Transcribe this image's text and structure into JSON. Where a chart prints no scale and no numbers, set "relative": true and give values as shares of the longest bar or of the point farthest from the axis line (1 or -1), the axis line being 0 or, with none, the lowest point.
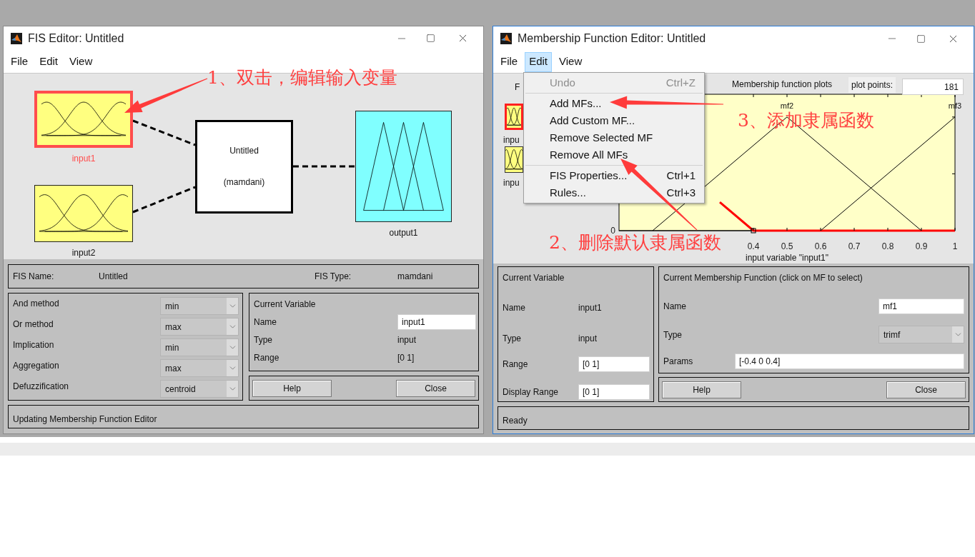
{
  "fis_editor": {
    "title": "FIS Editor: Untitled",
    "menu": [
      {
        "label": "File",
        "selected": false
      },
      {
        "label": "Edit",
        "selected": false
      },
      {
        "label": "View",
        "selected": false
      }
    ],
    "diagram": {
      "inputs": [
        {
          "label": "input1",
          "selected": true
        },
        {
          "label": "input2",
          "selected": false
        }
      ],
      "system": {
        "name": "Untitled",
        "type": "(mamdani)"
      },
      "output": {
        "label": "output1",
        "selected": false
      }
    },
    "fis_name_label": "FIS Name:",
    "fis_name": "Untitled",
    "fis_type_label": "FIS Type:",
    "fis_type": "mamdani",
    "methods": [
      {
        "label": "And method",
        "value": "min"
      },
      {
        "label": "Or method",
        "value": "max"
      },
      {
        "label": "Implication",
        "value": "min"
      },
      {
        "label": "Aggregation",
        "value": "max"
      },
      {
        "label": "Defuzzification",
        "value": "centroid"
      }
    ],
    "current_variable": {
      "title": "Current Variable",
      "name_label": "Name",
      "name": "input1",
      "type_label": "Type",
      "type": "input",
      "range_label": "Range",
      "range": "[0 1]"
    },
    "buttons": [
      "Help",
      "Close"
    ],
    "status": "Updating Membership Function Editor"
  },
  "mf_editor": {
    "title": "Membership Function Editor: Untitled",
    "menu": [
      {
        "label": "File",
        "selected": false
      },
      {
        "label": "Edit",
        "selected": true
      },
      {
        "label": "View",
        "selected": false
      }
    ],
    "variables_title": "F",
    "variables": [
      {
        "label": "inpu",
        "selected": true
      },
      {
        "label": "inpu",
        "selected": false
      }
    ],
    "plot_title": "Membership function plots",
    "plot_points_label": "plot points:",
    "plot_points": "181",
    "chart_data": {
      "type": "line",
      "x": [
        0.1,
        0.2,
        0.3,
        0.4,
        0.5,
        0.6,
        0.7,
        0.8,
        0.9,
        1
      ],
      "xlabel": "input variable \"input1\"",
      "xlim": [
        0,
        1
      ],
      "relative": true,
      "xticks": [
        0.4,
        0.5,
        0.6,
        0.7,
        0.8,
        0.9,
        1
      ],
      "legend": "top",
      "series": [
        {
          "color": "#ff0000",
          "values": [
            null,
            null,
            0.25,
            0,
            0,
            0,
            0,
            0,
            0,
            0
          ]
        },
        {
          "name": "mf2",
          "color": "#000000",
          "values": [
            0,
            0.25,
            0.5,
            0.75,
            1,
            0.75,
            0.5,
            0.25,
            0,
            null
          ]
        },
        {
          "name": "mf3",
          "color": "#000000",
          "values": [
            null,
            null,
            null,
            null,
            null,
            0,
            0.25,
            0.5,
            0.75,
            1
          ]
        }
      ],
      "annotations": [
        "0"
      ]
    },
    "edit_menu": [
      {
        "items": [
          {
            "label": "Undo",
            "shortcut": "Ctrl+Z",
            "disabled": true
          }
        ]
      },
      {
        "items": [
          {
            "label": "Add MFs...",
            "disabled": false
          },
          {
            "label": "Add Custom MF...",
            "disabled": false
          },
          {
            "label": "Remove Selected MF",
            "disabled": false
          },
          {
            "label": "Remove All MFs",
            "disabled": false
          }
        ]
      },
      {
        "items": [
          {
            "label": "FIS Properties...",
            "shortcut": "Ctrl+1",
            "disabled": false
          },
          {
            "label": "Rules...",
            "shortcut": "Ctrl+3",
            "disabled": false
          }
        ]
      }
    ],
    "current_variable": {
      "title": "Current Variable",
      "name_label": "Name",
      "name": "input1",
      "type_label": "Type",
      "type": "input",
      "range_label": "Range",
      "range": "[0 1]",
      "display_range_label": "Display Range",
      "display_range": "[0 1]"
    },
    "current_mf": {
      "title": "Current Membership Function (click on MF to select)",
      "name_label": "Name",
      "name": "mf1",
      "type_label": "Type",
      "type": "trimf",
      "params_label": "Params",
      "params": "[-0.4 0 0.4]"
    },
    "buttons": [
      "Help",
      "Close"
    ],
    "status": "Ready"
  },
  "annotations": [
    {
      "text": "1、双击，编辑输入变量"
    },
    {
      "text": "2、删除默认隶属函数"
    },
    {
      "text": "3、添加隶属函数"
    }
  ]
}
